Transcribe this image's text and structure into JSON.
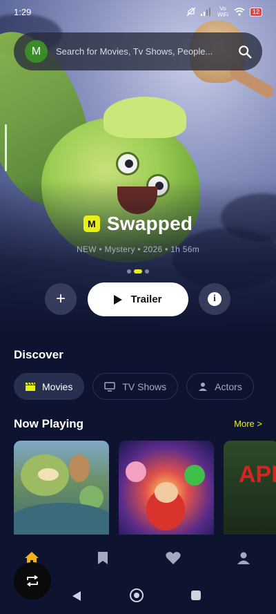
{
  "status_bar": {
    "time": "1:29",
    "network": "Vo WiFi",
    "battery": "12"
  },
  "search": {
    "avatar_letter": "M",
    "placeholder": "Search for Movies, Tv Shows, People..."
  },
  "hero": {
    "badge": "M",
    "title": "Swapped",
    "meta": "NEW • Mystery • 2026 • 1h 56m",
    "carousel": {
      "count": 3,
      "active_index": 1
    },
    "trailer_label": "Trailer",
    "add_symbol": "+",
    "info_symbol": "i"
  },
  "discover": {
    "title": "Discover",
    "chips": [
      {
        "label": "Movies",
        "icon": "clapperboard-icon",
        "active": true
      },
      {
        "label": "TV Shows",
        "icon": "tv-icon",
        "active": false
      },
      {
        "label": "Actors",
        "icon": "person-icon",
        "active": false
      }
    ]
  },
  "now_playing": {
    "title": "Now Playing",
    "more_label": "More >",
    "posters": [
      {
        "name": "poster-swapped"
      },
      {
        "name": "poster-mario"
      },
      {
        "name": "poster-partial",
        "visible_text": "APE"
      }
    ]
  },
  "bottom_nav": {
    "items": [
      {
        "icon": "home-icon",
        "active": true
      },
      {
        "icon": "bookmark-icon",
        "active": false
      },
      {
        "icon": "heart-icon",
        "active": false
      },
      {
        "icon": "profile-icon",
        "active": false
      }
    ],
    "fab_icon": "repeat-icon"
  },
  "colors": {
    "accent": "#e8f01a",
    "background": "#0e1430",
    "chip_active": "#283050"
  }
}
